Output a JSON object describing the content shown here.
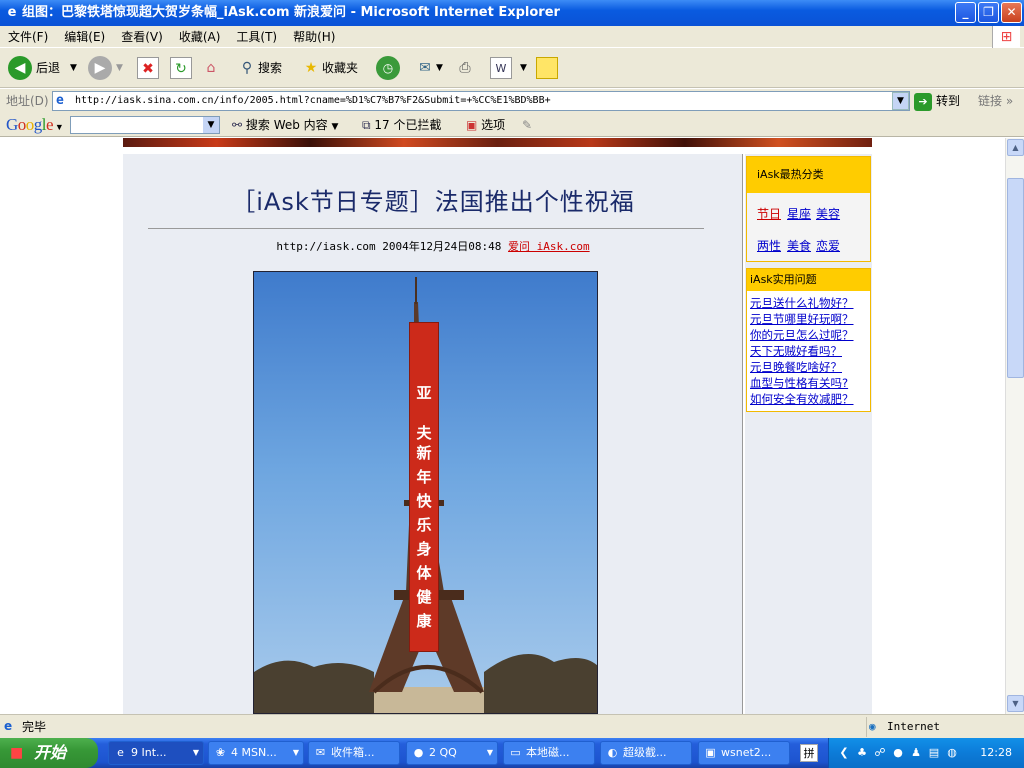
{
  "window": {
    "title": "组图：巴黎铁塔惊现超大贺岁条幅_iAsk.com 新浪爱问 - Microsoft Internet Explorer"
  },
  "menu": [
    "文件(F)",
    "编辑(E)",
    "查看(V)",
    "收藏(A)",
    "工具(T)",
    "帮助(H)"
  ],
  "toolbar": {
    "back_label": "后退",
    "search_label": "搜索",
    "favorites_label": "收藏夹"
  },
  "address": {
    "label": "地址(D)",
    "url": "http://iask.sina.com.cn/info/2005.html?cname=%D1%C7%B7%F2&Submit=+%CC%E1%BD%BB+",
    "go_label": "转到",
    "links_label": "链接"
  },
  "google_bar": {
    "logo": "Google",
    "search_web_label": "搜索 Web 内容",
    "blocked_label": "17 个已拦截",
    "options_label": "选项"
  },
  "article": {
    "title": "［iAsk节日专题］法国推出个性祝福",
    "byline_prefix": "http://iask.com 2004年12月24日08:48",
    "byline_link": "爱问 iAsk.com",
    "banner_text": [
      "亚",
      "夫",
      "新",
      "年",
      "快",
      "乐",
      "身",
      "体",
      "健",
      "康"
    ]
  },
  "sidebar": {
    "hot_title": "iAsk最热分类",
    "categories": [
      "节日",
      "星座",
      "美容",
      "两性",
      "美食",
      "恋爱"
    ],
    "practical_title": "iAsk实用问题",
    "questions": [
      "元旦送什么礼物好？",
      "元旦节哪里好玩啊？",
      "你的元旦怎么过呢？",
      "天下无贼好看吗？",
      "元旦晚餐吃啥好？",
      "血型与性格有关吗?",
      "如何安全有效减肥？"
    ]
  },
  "status": {
    "text": "完毕",
    "zone": "Internet"
  },
  "taskbar": {
    "start_label": "开始",
    "tasks": [
      "9 Int...",
      "4 MSN...",
      "收件箱...",
      "2 QQ",
      "本地磁...",
      "超级截...",
      "wsnet2..."
    ],
    "clock": "12:28"
  }
}
